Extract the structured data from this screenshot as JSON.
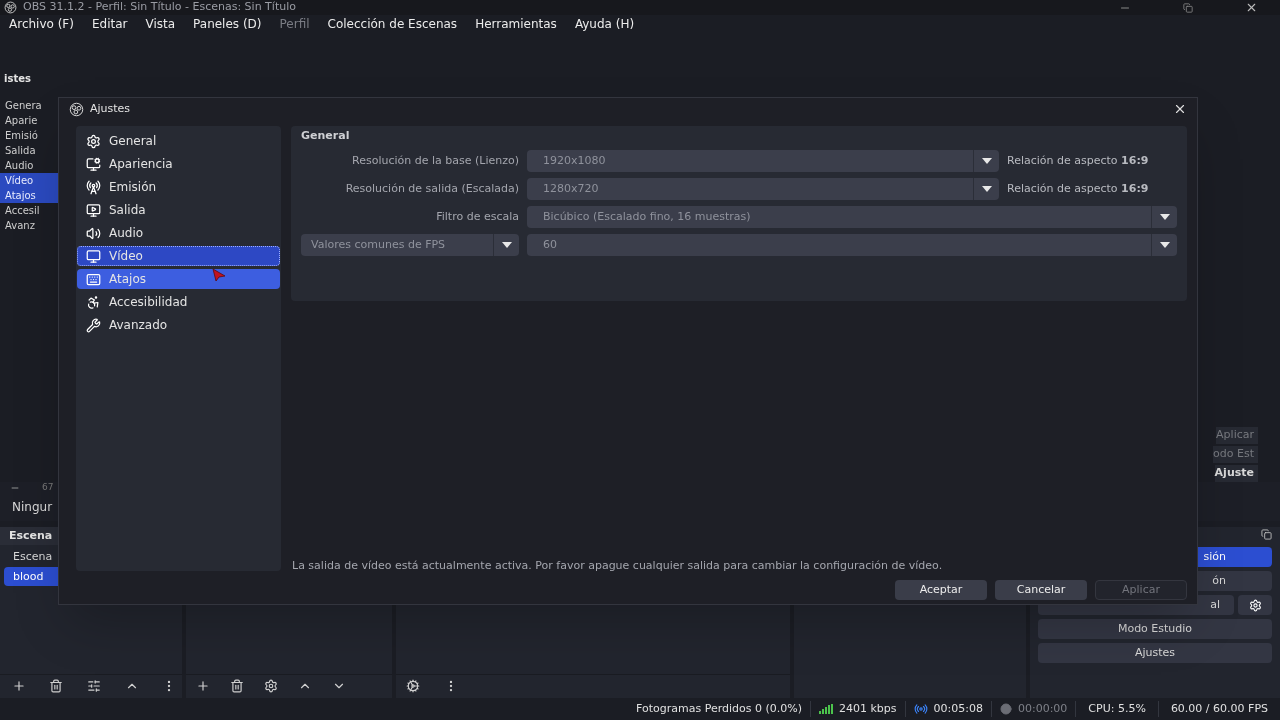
{
  "window": {
    "title": "OBS 31.1.2 - Perfil: Sin Título - Escenas: Sin Título"
  },
  "menu": [
    {
      "label": "Archivo (F)",
      "disabled": false
    },
    {
      "label": "Editar",
      "disabled": false
    },
    {
      "label": "Vista",
      "disabled": false
    },
    {
      "label": "Paneles (D)",
      "disabled": false
    },
    {
      "label": "Perfil",
      "disabled": true
    },
    {
      "label": "Colección de Escenas",
      "disabled": false
    },
    {
      "label": "Herramientas",
      "disabled": false
    },
    {
      "label": "Ayuda (H)",
      "disabled": false
    }
  ],
  "background_list": {
    "heading": "istes",
    "items": [
      {
        "label": "Genera",
        "selected": false
      },
      {
        "label": "Aparie",
        "selected": false
      },
      {
        "label": "Emisió",
        "selected": false
      },
      {
        "label": "Salida",
        "selected": false
      },
      {
        "label": "Audio",
        "selected": false
      },
      {
        "label": "Vídeo",
        "selected": true
      },
      {
        "label": "Atajos",
        "selected": true
      },
      {
        "label": "Accesil",
        "selected": false
      },
      {
        "label": "Avanz",
        "selected": false
      }
    ]
  },
  "background_buttons": [
    {
      "label": "Aplicar",
      "disabled": true
    },
    {
      "label": "odo Est",
      "disabled": true
    },
    {
      "label": "Ajuste",
      "disabled": false
    }
  ],
  "preview_bar": {
    "zoom": "67",
    "transition": "Ningur"
  },
  "scenes_dock": {
    "title": "Escena",
    "items": [
      {
        "label": "Escena",
        "selected": false
      },
      {
        "label": "blood",
        "selected": true
      }
    ]
  },
  "controls_dock": {
    "buttons": [
      {
        "label": "sión",
        "selected": true,
        "kind": "plain"
      },
      {
        "label": "ón",
        "selected": false,
        "kind": "plain"
      },
      {
        "label": "al",
        "selected": false,
        "kind": "gear"
      },
      {
        "label": "Modo Estudio",
        "selected": false,
        "kind": "plain"
      },
      {
        "label": "Ajustes",
        "selected": false,
        "kind": "plain"
      }
    ]
  },
  "status_bar": {
    "dropped": "Fotogramas Perdidos 0 (0.0%)",
    "bitrate": "2401 kbps",
    "stream_time": "00:05:08",
    "rec_time": "00:00:00",
    "cpu": "CPU: 5.5%",
    "fps": "60.00 / 60.00 FPS"
  },
  "dialog": {
    "title": "Ajustes",
    "nav": [
      {
        "label": "General",
        "selected": false,
        "hovered": false
      },
      {
        "label": "Apariencia",
        "selected": false,
        "hovered": false
      },
      {
        "label": "Emisión",
        "selected": false,
        "hovered": false
      },
      {
        "label": "Salida",
        "selected": false,
        "hovered": false
      },
      {
        "label": "Audio",
        "selected": false,
        "hovered": false
      },
      {
        "label": "Vídeo",
        "selected": true,
        "hovered": false
      },
      {
        "label": "Atajos",
        "selected": false,
        "hovered": true
      },
      {
        "label": "Accesibilidad",
        "selected": false,
        "hovered": false
      },
      {
        "label": "Avanzado",
        "selected": false,
        "hovered": false
      }
    ],
    "section_title": "General",
    "fields": [
      {
        "kind": "labeled",
        "label": "Resolución de la base (Lienzo)",
        "value": "1920x1080",
        "note": "Relación de aspecto **16:9**"
      },
      {
        "kind": "labeled",
        "label": "Resolución de salida (Escalada)",
        "value": "1280x720",
        "note": "Relación de aspecto **16:9**"
      },
      {
        "kind": "labeled",
        "label": "Filtro de escala",
        "value": "Bicúbico (Escalado fino, 16 muestras)"
      },
      {
        "kind": "combo",
        "label": "Valores comunes de FPS",
        "value": "60"
      }
    ],
    "message": "La salida de vídeo está actualmente activa. Por favor apague cualquier salida para cambiar la configuración de vídeo.",
    "buttons": [
      {
        "label": "Aceptar",
        "disabled": false
      },
      {
        "label": "Cancelar",
        "disabled": false
      },
      {
        "label": "Aplicar",
        "disabled": true
      }
    ]
  }
}
